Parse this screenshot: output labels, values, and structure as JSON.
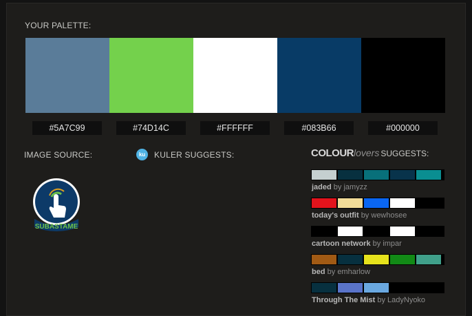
{
  "headings": {
    "your_palette": "YOUR PALETTE:",
    "image_source": "IMAGE SOURCE:",
    "kuler_suggests": "KULER SUGGESTS:",
    "cl_bold": "COLOUR",
    "cl_light": "lovers",
    "cl_suggests": "SUGGESTS:"
  },
  "kuler_icon_text": "ku",
  "palette": [
    {
      "hex": "#5A7C99",
      "color": "#5A7C99"
    },
    {
      "hex": "#74D14C",
      "color": "#74D14C"
    },
    {
      "hex": "#FFFFFF",
      "color": "#FFFFFF"
    },
    {
      "hex": "#083B66",
      "color": "#083B66"
    },
    {
      "hex": "#000000",
      "color": "#000000"
    }
  ],
  "image_source": {
    "logo_text": "SUBASTAME",
    "logo_colors": {
      "ring": "#0d3a68",
      "text": "#6cc04a",
      "accent": "#e0a020"
    }
  },
  "suggestions": [
    {
      "name": "jaded",
      "by": "by",
      "author": "jamyzz",
      "colors": [
        "#c5cfd0",
        "#07303f",
        "#08707a",
        "#08334b",
        "#0a8e91"
      ]
    },
    {
      "name": "today's outfit",
      "by": "by",
      "author": "wewhosee",
      "colors": [
        "#e3131c",
        "#f2dc98",
        "#0a66f2",
        "#ffffff",
        "#000000"
      ]
    },
    {
      "name": "cartoon network",
      "by": "by",
      "author": "impar",
      "colors": [
        "#000000",
        "#ffffff",
        "#000000",
        "#ffffff",
        "#000000"
      ]
    },
    {
      "name": "bed",
      "by": "by",
      "author": "emharlow",
      "colors": [
        "#a15a14",
        "#07303f",
        "#e6e21c",
        "#128a16",
        "#40a08a"
      ]
    },
    {
      "name": "Through The Mist",
      "by": "by",
      "author": "LadyNyoko",
      "colors": [
        "#07303f",
        "#5a74c9",
        "#6aa8e0",
        "#000000",
        "#000000"
      ]
    }
  ]
}
